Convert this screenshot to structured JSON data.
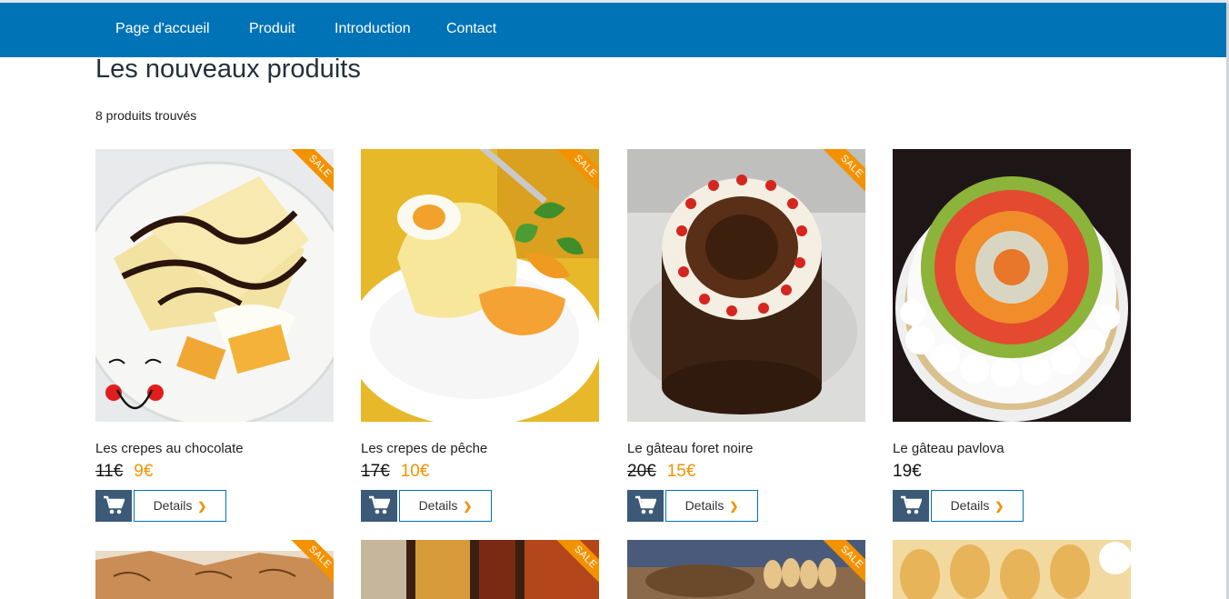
{
  "nav": {
    "items": [
      "Page d'accueil",
      "Produit",
      "Introduction",
      "Contact"
    ]
  },
  "page": {
    "title": "Les nouveaux produits",
    "count": "8 produits trouvés"
  },
  "products": [
    {
      "name": "Les crepes au chocolate",
      "old_price": "11€",
      "price": "9€",
      "sale": "SALE",
      "details": "Details"
    },
    {
      "name": "Les crepes de pêche",
      "old_price": "17€",
      "price": "10€",
      "sale": "SALE",
      "details": "Details"
    },
    {
      "name": "Le gâteau foret noire",
      "old_price": "20€",
      "price": "15€",
      "sale": "SALE",
      "details": "Details"
    },
    {
      "name": "Le gâteau pavlova",
      "price": "19€",
      "details": "Details"
    }
  ],
  "second_row": [
    {
      "sale": "SALE"
    },
    {
      "sale": "SALE"
    },
    {
      "sale": "SALE"
    },
    {}
  ],
  "colors": {
    "navbar": "#0073b7",
    "sale_accent": "#f39200",
    "cart_button": "#3c5a78"
  },
  "icons": {
    "cart": "cart-icon",
    "details": "chevron-right-icon"
  }
}
